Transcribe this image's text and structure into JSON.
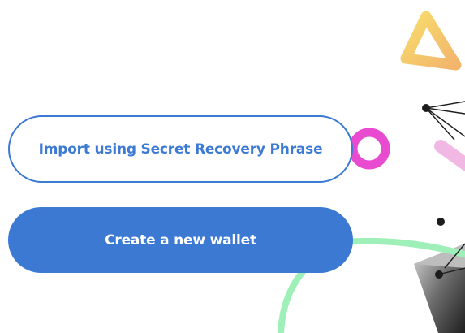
{
  "onboarding": {
    "import_button_label": "Import using Secret Recovery Phrase",
    "create_button_label": "Create a new wallet"
  },
  "colors": {
    "primary": "#3b79d3",
    "primary_outline": "#3d7ad4",
    "decor_yellow": "#f6cf65",
    "decor_pink": "#e84bcf",
    "decor_light_pink": "#f2b8e4",
    "decor_green": "#9ef0b8",
    "decor_dark": "#1d1d1d"
  },
  "decorations": {
    "triangle": "triangle-shape",
    "ring": "ring-shape",
    "pill": "pill-shape",
    "curve": "green-curve",
    "network": "node-network",
    "pyramid": "dark-pyramid"
  }
}
